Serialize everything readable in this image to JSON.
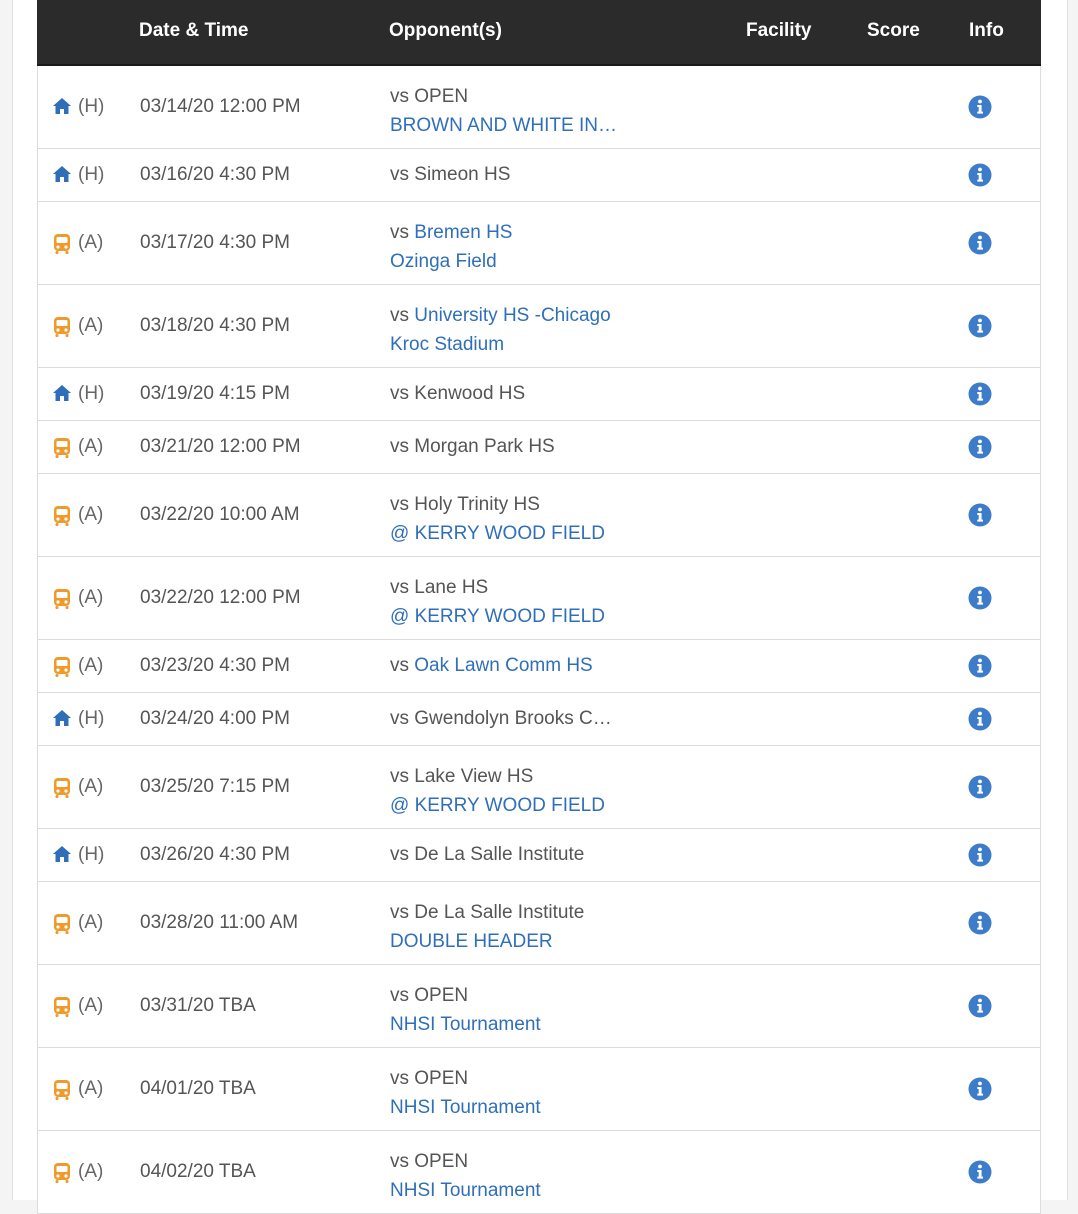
{
  "colors": {
    "home": "#2f6fba",
    "away": "#ef9a2b",
    "link": "#2f6fba",
    "info": "#3d7cc9",
    "header_bg": "#2b2b2b"
  },
  "header": {
    "date_time": "Date & Time",
    "opponents": "Opponent(s)",
    "facility": "Facility",
    "score": "Score",
    "info": "Info"
  },
  "games": [
    {
      "loc": "(H)",
      "icon": "home-icon",
      "datetime": "03/14/20 12:00 PM",
      "vs": "vs OPEN",
      "vs_link": "",
      "line2": "BROWN AND WHITE IN…"
    },
    {
      "loc": "(H)",
      "icon": "home-icon",
      "datetime": "03/16/20 4:30 PM",
      "vs": "vs Simeon HS",
      "vs_link": "",
      "line2": ""
    },
    {
      "loc": "(A)",
      "icon": "bus-icon",
      "datetime": "03/17/20 4:30 PM",
      "vs": "vs ",
      "vs_link": "Bremen HS",
      "line2": "Ozinga Field"
    },
    {
      "loc": "(A)",
      "icon": "bus-icon",
      "datetime": "03/18/20 4:30 PM",
      "vs": "vs ",
      "vs_link": "University HS -Chicago",
      "line2": "Kroc Stadium"
    },
    {
      "loc": "(H)",
      "icon": "home-icon",
      "datetime": "03/19/20 4:15 PM",
      "vs": "vs Kenwood HS",
      "vs_link": "",
      "line2": ""
    },
    {
      "loc": "(A)",
      "icon": "bus-icon",
      "datetime": "03/21/20 12:00 PM",
      "vs": "vs Morgan Park HS",
      "vs_link": "",
      "line2": ""
    },
    {
      "loc": "(A)",
      "icon": "bus-icon",
      "datetime": "03/22/20 10:00 AM",
      "vs": "vs Holy Trinity HS",
      "vs_link": "",
      "line2": "@ KERRY WOOD FIELD"
    },
    {
      "loc": "(A)",
      "icon": "bus-icon",
      "datetime": "03/22/20 12:00 PM",
      "vs": "vs Lane HS",
      "vs_link": "",
      "line2": "@ KERRY WOOD FIELD"
    },
    {
      "loc": "(A)",
      "icon": "bus-icon",
      "datetime": "03/23/20 4:30 PM",
      "vs": "vs ",
      "vs_link": "Oak Lawn Comm HS",
      "line2": ""
    },
    {
      "loc": "(H)",
      "icon": "home-icon",
      "datetime": "03/24/20 4:00 PM",
      "vs": "vs Gwendolyn Brooks C…",
      "vs_link": "",
      "line2": ""
    },
    {
      "loc": "(A)",
      "icon": "bus-icon",
      "datetime": "03/25/20 7:15 PM",
      "vs": "vs Lake View HS",
      "vs_link": "",
      "line2": "@ KERRY WOOD FIELD"
    },
    {
      "loc": "(H)",
      "icon": "home-icon",
      "datetime": "03/26/20 4:30 PM",
      "vs": "vs De La Salle Institute",
      "vs_link": "",
      "line2": ""
    },
    {
      "loc": "(A)",
      "icon": "bus-icon",
      "datetime": "03/28/20 11:00 AM",
      "vs": "vs De La Salle Institute",
      "vs_link": "",
      "line2": "DOUBLE HEADER"
    },
    {
      "loc": "(A)",
      "icon": "bus-icon",
      "datetime": "03/31/20 TBA",
      "vs": "vs OPEN",
      "vs_link": "",
      "line2": "NHSI Tournament"
    },
    {
      "loc": "(A)",
      "icon": "bus-icon",
      "datetime": "04/01/20 TBA",
      "vs": "vs OPEN",
      "vs_link": "",
      "line2": "NHSI Tournament"
    },
    {
      "loc": "(A)",
      "icon": "bus-icon",
      "datetime": "04/02/20 TBA",
      "vs": "vs OPEN",
      "vs_link": "",
      "line2": "NHSI Tournament"
    }
  ]
}
